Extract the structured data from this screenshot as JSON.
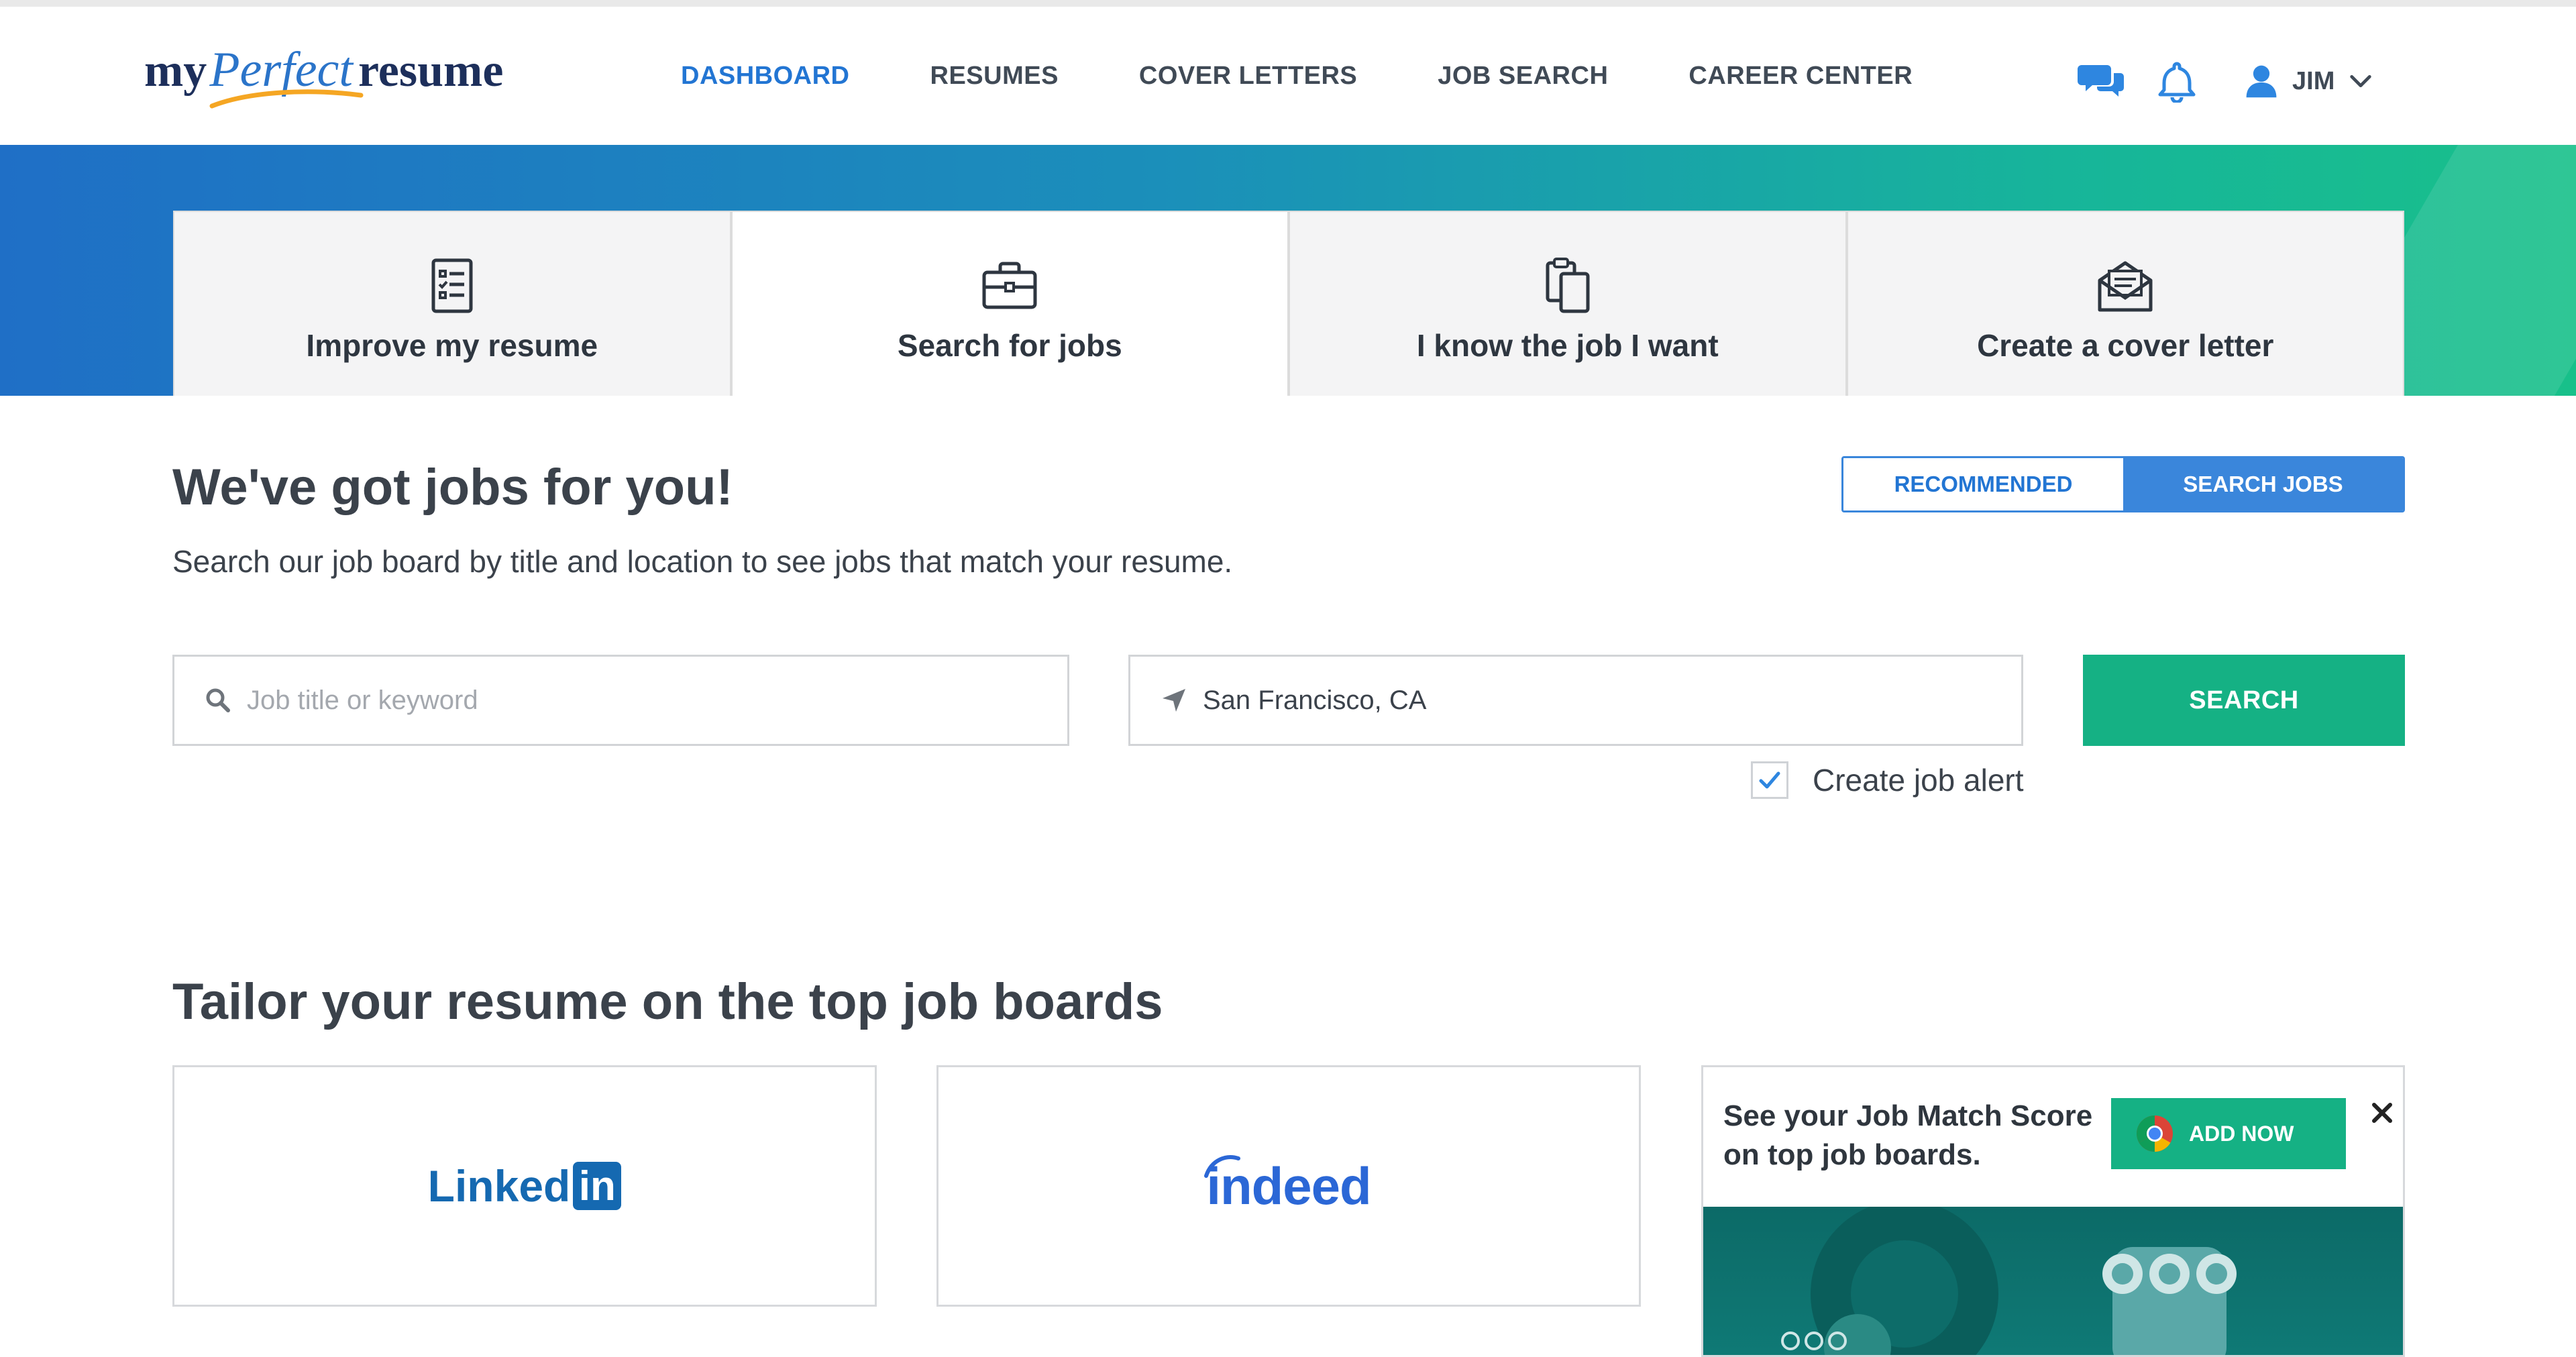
{
  "brand": {
    "logo_my": "my",
    "logo_perfect": "Perfect",
    "logo_resume": "resume"
  },
  "nav": {
    "links": [
      "DASHBOARD",
      "RESUMES",
      "COVER LETTERS",
      "JOB SEARCH",
      "CAREER CENTER"
    ],
    "active": "DASHBOARD",
    "user_name": "JIM",
    "icons": [
      "chat-icon",
      "bell-icon",
      "user-icon",
      "chevron-down-icon"
    ]
  },
  "tabs": [
    {
      "label": "Improve my resume",
      "icon": "checklist-icon"
    },
    {
      "label": "Search for jobs",
      "icon": "briefcase-icon"
    },
    {
      "label": "I know the job I want",
      "icon": "clipboard-icon"
    },
    {
      "label": "Create a cover letter",
      "icon": "envelope-icon"
    }
  ],
  "selected_tab": "Search for jobs",
  "search": {
    "title": "We've got jobs for you!",
    "subtitle": "Search our job board by title and location to see jobs that match your resume.",
    "toggle_recommended": "RECOMMENDED",
    "toggle_search": "SEARCH JOBS",
    "toggle_active": "SEARCH JOBS",
    "keyword_placeholder": "Job title or keyword",
    "keyword_value": "",
    "location_value": "San Francisco, CA",
    "search_button": "SEARCH",
    "alert_label": "Create job alert",
    "alert_checked": true
  },
  "boards": {
    "title": "Tailor your resume on the top job boards",
    "linkedin_text": "Linked",
    "linkedin_in": "in",
    "indeed_text": "indeed",
    "promo_text": "See your Job Match Score on top job boards.",
    "promo_button": "ADD NOW"
  },
  "colors": {
    "accent_blue": "#2275d3",
    "green": "#15b184",
    "gradient_start": "#1f6fc6",
    "gradient_end": "#18c08a"
  }
}
